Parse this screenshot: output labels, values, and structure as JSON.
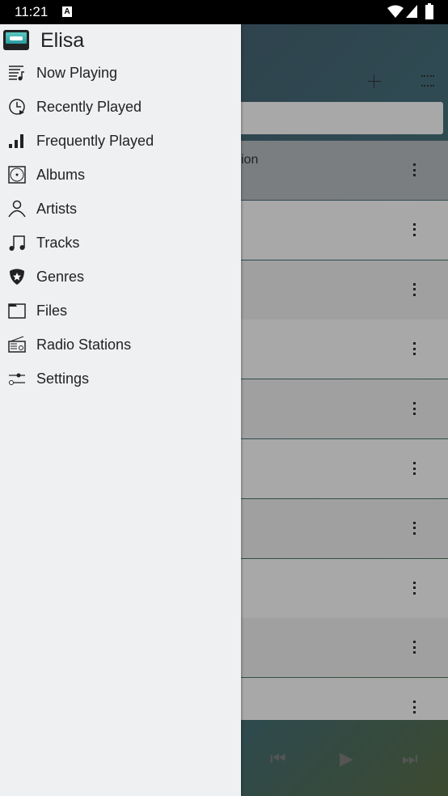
{
  "status_bar": {
    "time": "11:21",
    "notification_icon": "A"
  },
  "app": {
    "title": "Elisa"
  },
  "drawer": {
    "items": [
      {
        "label": "Now Playing",
        "icon": "now-playing-icon"
      },
      {
        "label": "Recently Played",
        "icon": "recent-icon"
      },
      {
        "label": "Frequently Played",
        "icon": "frequent-icon"
      },
      {
        "label": "Albums",
        "icon": "album-icon"
      },
      {
        "label": "Artists",
        "icon": "artist-icon"
      },
      {
        "label": "Tracks",
        "icon": "music-note-icon"
      },
      {
        "label": "Genres",
        "icon": "genre-icon"
      },
      {
        "label": "Files",
        "icon": "folder-icon"
      },
      {
        "label": "Radio Stations",
        "icon": "radio-icon"
      },
      {
        "label": "Settings",
        "icon": "settings-icon"
      }
    ]
  },
  "background": {
    "first_row_partial_text": "ion"
  }
}
